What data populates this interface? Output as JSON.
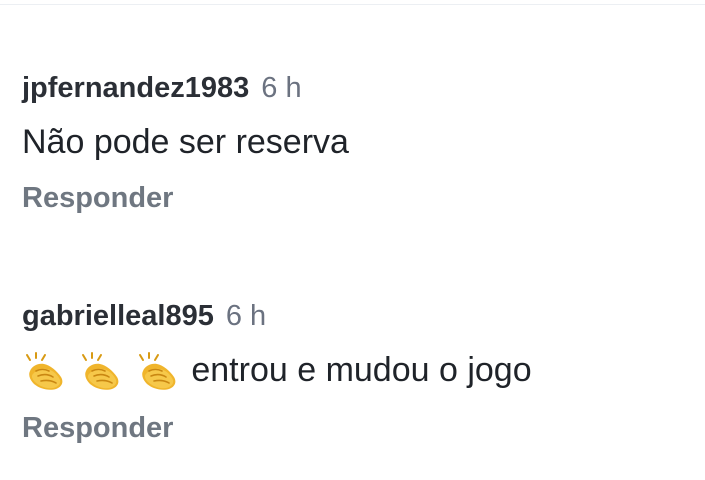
{
  "comments": [
    {
      "username": "jpfernandez1983",
      "time": "6 h",
      "text": "Não pode ser reserva",
      "reply_label": "Responder"
    },
    {
      "username": "gabrielleal895",
      "time": "6 h",
      "emojis": [
        "clapping-hands",
        "clapping-hands",
        "clapping-hands"
      ],
      "text": "entrou e mudou o jogo",
      "reply_label": "Responder"
    }
  ]
}
